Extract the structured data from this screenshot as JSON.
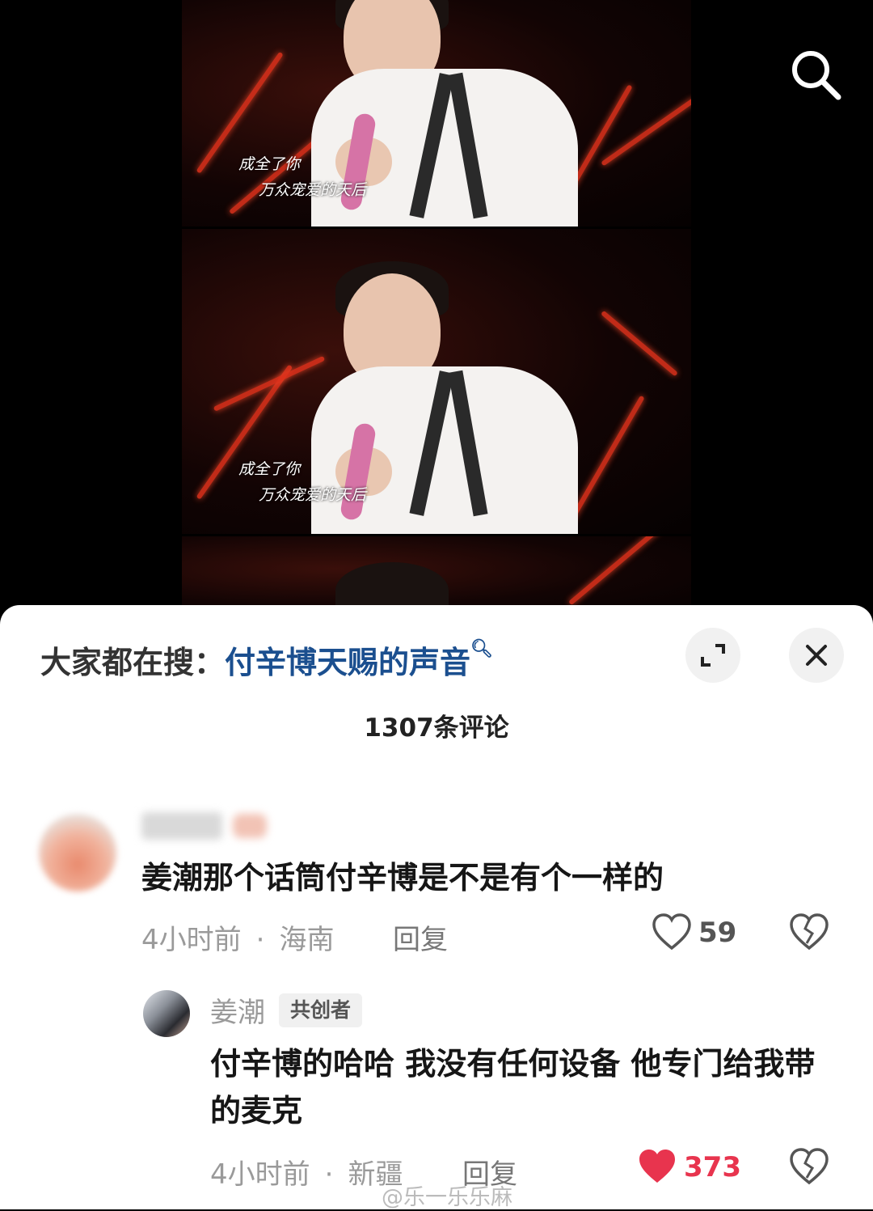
{
  "video": {
    "subtitle_line1": "成全了你",
    "subtitle_line2": "万众宠爱的天后",
    "icon": "search-icon"
  },
  "sheet": {
    "trending_prefix": "大家都在搜：",
    "trending_topic": "付辛博天赐的声音",
    "expand_icon": "expand-icon",
    "close_icon": "close-icon",
    "comment_count": "1307条评论"
  },
  "comments": [
    {
      "text": "姜潮那个话筒付辛博是不是有个一样的",
      "time": "4小时前",
      "location": "海南",
      "reply_label": "回复",
      "likes": "59",
      "liked": false
    }
  ],
  "reply": {
    "username": "姜潮",
    "badge": "共创者",
    "text": "付辛博的哈哈 我没有任何设备 他专门给我带的麦克",
    "time": "4小时前",
    "location": "新疆",
    "reply_label": "回复",
    "likes": "373",
    "liked": true
  },
  "watermark": "@乐一乐乐麻",
  "colors": {
    "like_red": "#e8344e",
    "topic_blue": "#1b4f8f"
  }
}
